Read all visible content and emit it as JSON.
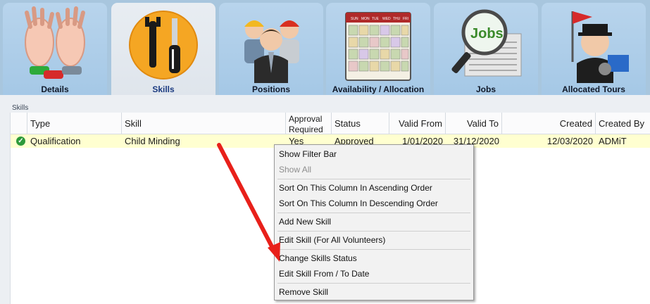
{
  "tabs": [
    {
      "label": "Details",
      "icon": "hands-icon"
    },
    {
      "label": "Skills",
      "icon": "tools-icon",
      "active": true
    },
    {
      "label": "Positions",
      "icon": "workers-icon"
    },
    {
      "label": "Availability / Allocation",
      "icon": "calendar-icon"
    },
    {
      "label": "Jobs",
      "icon": "jobs-magnifier-icon"
    },
    {
      "label": "Allocated Tours",
      "icon": "tour-flag-icon"
    }
  ],
  "calendar_days": [
    "SUN",
    "MON",
    "TUE",
    "WED",
    "THU",
    "FRI"
  ],
  "jobs_word": "Jobs",
  "section": {
    "title": "Skills"
  },
  "grid": {
    "columns": [
      "Type",
      "Skill",
      "Approval Required",
      "Status",
      "Valid From",
      "Valid To",
      "Created",
      "Created By"
    ],
    "columns_two_line": {
      "line1": "Approval",
      "line2": "Required"
    },
    "rows": [
      {
        "status_icon": "check-icon",
        "type": "Qualification",
        "skill": "Child Minding",
        "approval_required": "Yes",
        "status": "Approved",
        "valid_from": "1/01/2020",
        "valid_to": "31/12/2020",
        "created": "12/03/2020",
        "created_by": "ADMiT"
      }
    ]
  },
  "context_menu": {
    "items": [
      {
        "label": "Show Filter Bar",
        "enabled": true
      },
      {
        "label": "Show All",
        "enabled": false
      },
      {
        "label": "Sort On This Column In Ascending Order",
        "enabled": true
      },
      {
        "label": "Sort On This Column In Descending Order",
        "enabled": true
      },
      {
        "label": "Add New Skill",
        "enabled": true
      },
      {
        "label": "Edit Skill (For All Volunteers)",
        "enabled": true
      },
      {
        "label": "Change Skills Status",
        "enabled": true
      },
      {
        "label": "Edit Skill From / To Date",
        "enabled": true
      },
      {
        "label": "Remove Skill",
        "enabled": true
      }
    ]
  },
  "colors": {
    "tab_bar": "#a8c6de",
    "active_tab": "#e4eaf0",
    "selected_row": "#ffffd0",
    "annotation_arrow": "#e8201a",
    "active_label": "#1a3a80"
  }
}
